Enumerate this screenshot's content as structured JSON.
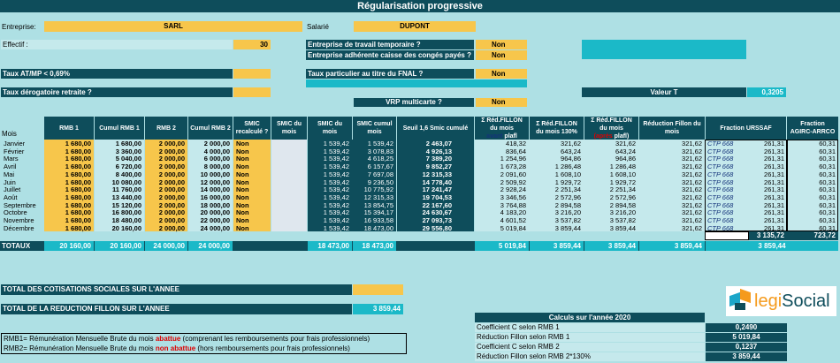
{
  "title": "Régularisation progressive",
  "entreprise": {
    "label": "Entreprise:",
    "value": "SARL"
  },
  "salarie": {
    "label": "Salarié",
    "value": "DUPONT"
  },
  "effectif": {
    "label": "Effectif :",
    "value": "30"
  },
  "q_temp": {
    "label": "Entreprise de travail temporaire ?",
    "value": "Non"
  },
  "q_conges": {
    "label": "Entreprise adhérente caisse des congés payés ?",
    "value": "Non"
  },
  "taux_atmp": {
    "label": "Taux AT/MP < 0,69%"
  },
  "taux_fnal": {
    "label": "Taux particulier au titre du FNAL ?",
    "value": "Non"
  },
  "taux_derog": {
    "label": "Taux dérogatoire retraite ?"
  },
  "valeur_t": {
    "label": "Valeur T",
    "value": "0,3205"
  },
  "vrp": {
    "label": "VRP multicarte ?",
    "value": "Non"
  },
  "headers": {
    "mois": "Mois",
    "rmb1": "RMB 1",
    "cum_rmb1": "Cumul RMB 1",
    "rmb2": "RMB 2",
    "cum_rmb2": "Cumul RMB 2",
    "smic_recalc": "SMIC recalculé ?",
    "smic_du_mois": "SMIC du mois",
    "smic_mois2": "SMIC du mois",
    "smic_cumul": "SMIC cumul mois",
    "seuil": "Seuil 1,6 Smic cumulé",
    "red1a": "Σ Réd.FILLON du mois",
    "red1b": "avant",
    "red1c": "plafl",
    "red2": "Σ Réd.FILLON du mois 130%",
    "red3a": "Σ Réd.FILLON du mois",
    "red3b": "(après",
    "red3c": "plafl)",
    "red4": "Réduction Fillon du mois",
    "urssaf": "Fraction URSSAF",
    "agirc": "Fraction AGIRC-ARRCO"
  },
  "rows": [
    [
      "Janvier",
      "1 680,00",
      "1 680,00",
      "2 000,00",
      "2 000,00",
      "Non",
      "1 539,42",
      "1 539,42",
      "2 463,07",
      "418,32",
      "321,62",
      "321,62",
      "321,62",
      "CTP 668",
      "261,31",
      "60,31"
    ],
    [
      "Février",
      "1 680,00",
      "3 360,00",
      "2 000,00",
      "4 000,00",
      "Non",
      "1 539,42",
      "3 078,83",
      "4 926,13",
      "836,64",
      "643,24",
      "643,24",
      "321,62",
      "CTP 668",
      "261,31",
      "60,31"
    ],
    [
      "Mars",
      "1 680,00",
      "5 040,00",
      "2 000,00",
      "6 000,00",
      "Non",
      "1 539,42",
      "4 618,25",
      "7 389,20",
      "1 254,96",
      "964,86",
      "964,86",
      "321,62",
      "CTP 668",
      "261,31",
      "60,31"
    ],
    [
      "Avril",
      "1 680,00",
      "6 720,00",
      "2 000,00",
      "8 000,00",
      "Non",
      "1 539,42",
      "6 157,67",
      "9 852,27",
      "1 673,28",
      "1 286,48",
      "1 286,48",
      "321,62",
      "CTP 668",
      "261,31",
      "60,31"
    ],
    [
      "Mai",
      "1 680,00",
      "8 400,00",
      "2 000,00",
      "10 000,00",
      "Non",
      "1 539,42",
      "7 697,08",
      "12 315,33",
      "2 091,60",
      "1 608,10",
      "1 608,10",
      "321,62",
      "CTP 668",
      "261,31",
      "60,31"
    ],
    [
      "Juin",
      "1 680,00",
      "10 080,00",
      "2 000,00",
      "12 000,00",
      "Non",
      "1 539,42",
      "9 236,50",
      "14 778,40",
      "2 509,92",
      "1 929,72",
      "1 929,72",
      "321,62",
      "CTP 668",
      "261,31",
      "60,31"
    ],
    [
      "Juillet",
      "1 680,00",
      "11 760,00",
      "2 000,00",
      "14 000,00",
      "Non",
      "1 539,42",
      "10 775,92",
      "17 241,47",
      "2 928,24",
      "2 251,34",
      "2 251,34",
      "321,62",
      "CTP 668",
      "261,31",
      "60,31"
    ],
    [
      "Août",
      "1 680,00",
      "13 440,00",
      "2 000,00",
      "16 000,00",
      "Non",
      "1 539,42",
      "12 315,33",
      "19 704,53",
      "3 346,56",
      "2 572,96",
      "2 572,96",
      "321,62",
      "CTP 668",
      "261,31",
      "60,31"
    ],
    [
      "Septembre",
      "1 680,00",
      "15 120,00",
      "2 000,00",
      "18 000,00",
      "Non",
      "1 539,42",
      "13 854,75",
      "22 167,60",
      "3 764,88",
      "2 894,58",
      "2 894,58",
      "321,62",
      "CTP 668",
      "261,31",
      "60,31"
    ],
    [
      "Octobre",
      "1 680,00",
      "16 800,00",
      "2 000,00",
      "20 000,00",
      "Non",
      "1 539,42",
      "15 394,17",
      "24 630,67",
      "4 183,20",
      "3 216,20",
      "3 216,20",
      "321,62",
      "CTP 668",
      "261,31",
      "60,31"
    ],
    [
      "Novembre",
      "1 680,00",
      "18 480,00",
      "2 000,00",
      "22 000,00",
      "Non",
      "1 539,42",
      "16 933,58",
      "27 093,73",
      "4 601,52",
      "3 537,82",
      "3 537,82",
      "321,62",
      "CTP 668",
      "261,31",
      "60,31"
    ],
    [
      "Décembre",
      "1 680,00",
      "20 160,00",
      "2 000,00",
      "24 000,00",
      "Non",
      "1 539,42",
      "18 473,00",
      "29 556,80",
      "5 019,84",
      "3 859,44",
      "3 859,44",
      "321,62",
      "CTP 668",
      "261,31",
      "60,31"
    ]
  ],
  "subtotals": {
    "urssaf": "3 135,72",
    "agirc": "723,72"
  },
  "totaux": {
    "label": "TOTAUX",
    "rmb1": "20 160,00",
    "cum_rmb1": "20 160,00",
    "rmb2": "24 000,00",
    "cum_rmb2": "24 000,00",
    "smic": "18 473,00",
    "smic_cumul": "18 473,00",
    "red1": "5 019,84",
    "red2": "3 859,44",
    "red3": "3 859,44",
    "red4": "3 859,44",
    "red_total": "3 859,44"
  },
  "total_cotis": {
    "label": "TOTAL DES COTISATIONS SOCIALES SUR L'ANNEE"
  },
  "total_fillon": {
    "label": "TOTAL DE LA REDUCTION FILLON SUR L'ANNEE",
    "value": "3 859,44"
  },
  "notes": {
    "rmb1_a": "RMB1= Rémunération Mensuelle Brute du mois ",
    "rmb1_b": "abattue",
    "rmb1_c": " (comprenant les remboursements pour frais professionnels)",
    "rmb2_a": "RMB2= Rémunération Mensuelle Brute du mois ",
    "rmb2_b": "non abattue",
    "rmb2_c": " (hors remboursements pour frais professionnels)"
  },
  "logo": {
    "text_a": "legi",
    "text_b": "Social"
  },
  "calc": {
    "title": "Calculs sur l'année 2020",
    "rows": [
      [
        "Coefficient C selon RMB 1",
        "0,2490"
      ],
      [
        "Réduction Fillon selon RMB 1",
        "5 019,84"
      ],
      [
        "Coefficient C selon RMB 2",
        "0,1237"
      ],
      [
        "Réduction Fillon selon RMB 2*130%",
        "3 859,44"
      ]
    ]
  },
  "colors": {
    "dark": "#0e4d5b",
    "yellow": "#f7c64b",
    "cyan": "#1bb9c8",
    "light": "#c5e9ec",
    "bg": "#aee0e4"
  }
}
